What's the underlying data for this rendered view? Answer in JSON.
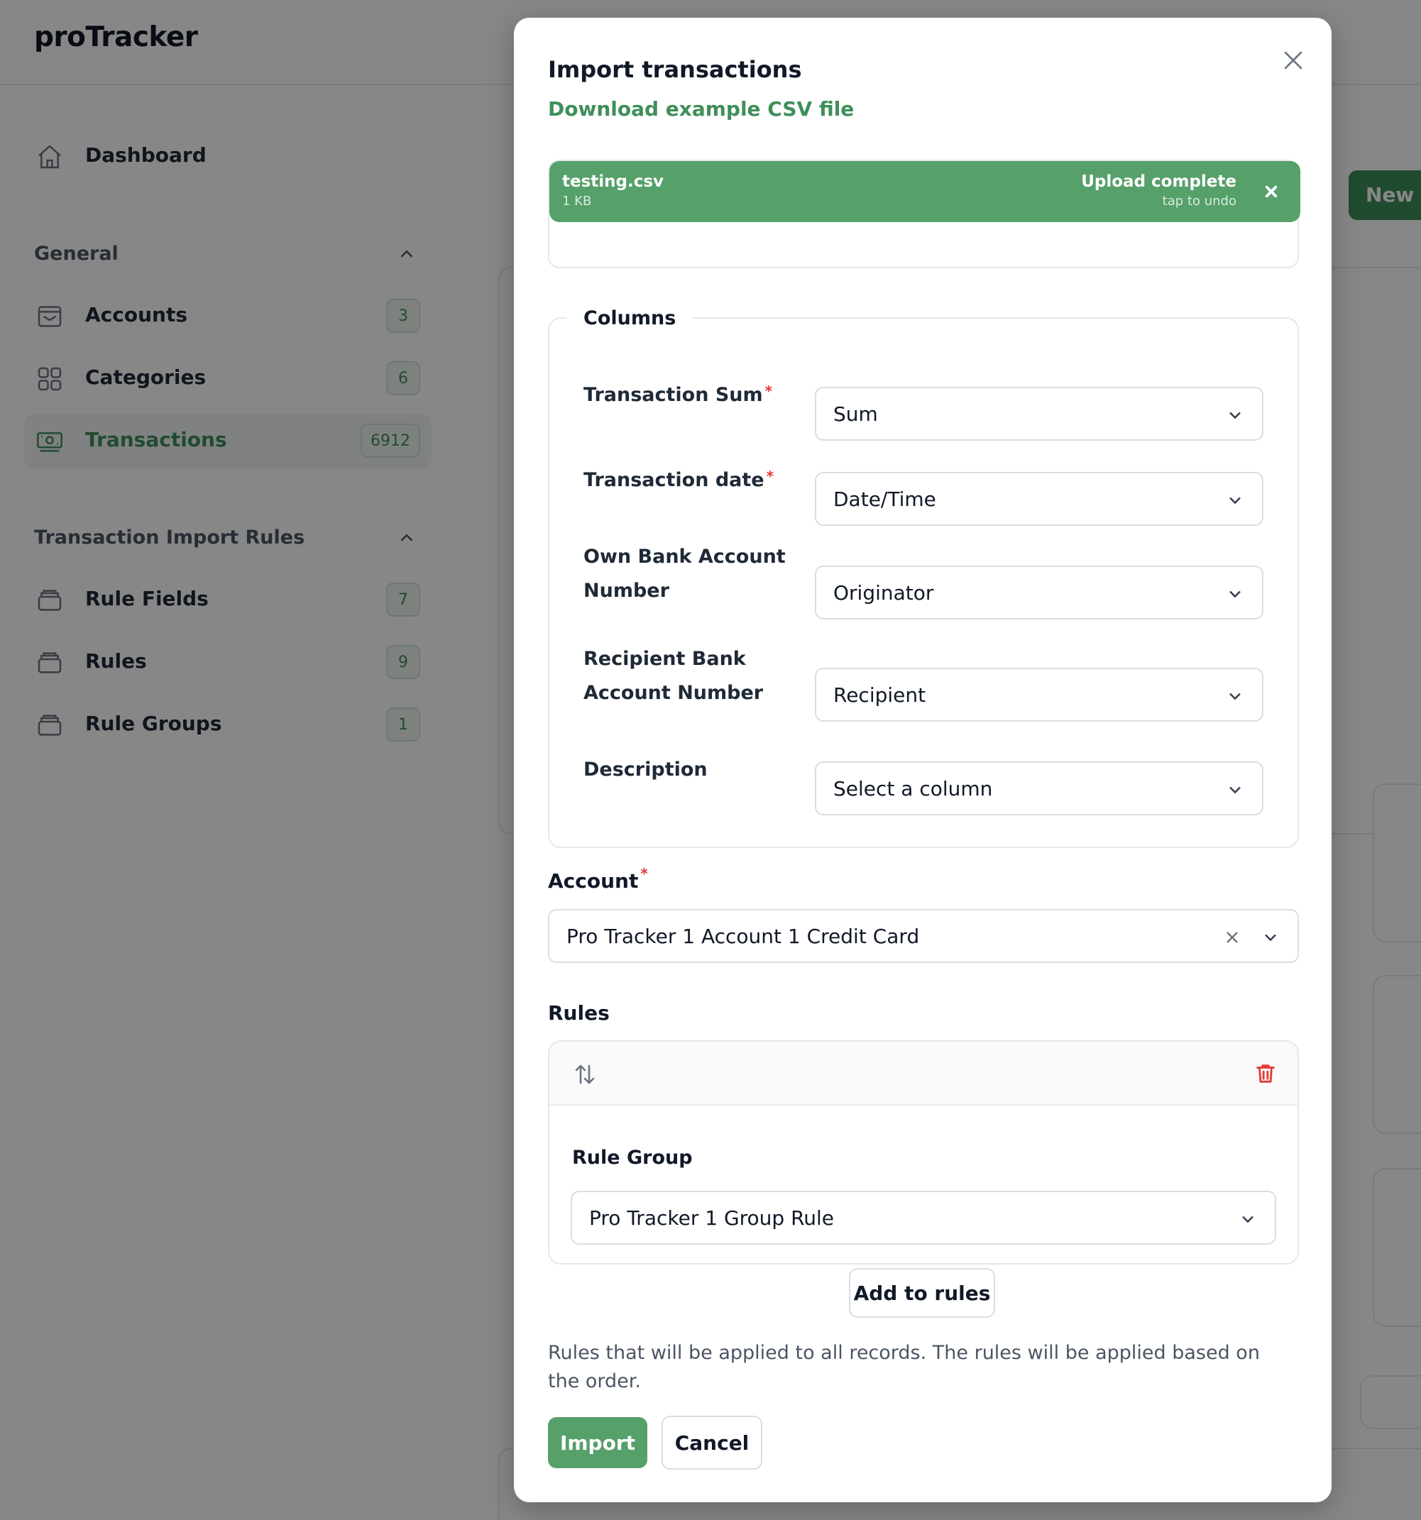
{
  "app": {
    "logo": "proTracker",
    "background_button": "New t"
  },
  "sidebar": {
    "dashboard": "Dashboard",
    "general_section": "General",
    "general_items": [
      {
        "label": "Accounts",
        "count": "3"
      },
      {
        "label": "Categories",
        "count": "6"
      },
      {
        "label": "Transactions",
        "count": "6912"
      }
    ],
    "rules_section": "Transaction Import Rules",
    "rules_items": [
      {
        "label": "Rule Fields",
        "count": "7"
      },
      {
        "label": "Rules",
        "count": "9"
      },
      {
        "label": "Rule Groups",
        "count": "1"
      }
    ]
  },
  "modal": {
    "title": "Import transactions",
    "download_link": "Download example CSV file",
    "upload": {
      "file_name": "testing.csv",
      "file_size": "1 KB",
      "status": "Upload complete",
      "undo_hint": "tap to undo"
    },
    "columns": {
      "legend": "Columns",
      "fields": [
        {
          "label": "Transaction Sum",
          "required": "*",
          "value": "Sum"
        },
        {
          "label": "Transaction date",
          "required": "*",
          "value": "Date/Time"
        },
        {
          "label_line1": "Own Bank Account",
          "label_line2": "Number",
          "value": "Originator"
        },
        {
          "label_line1": "Recipient Bank",
          "label_line2": "Account Number",
          "value": "Recipient"
        },
        {
          "label": "Description",
          "value": "Select a column"
        }
      ]
    },
    "account": {
      "label": "Account",
      "required": "*",
      "value": "Pro Tracker 1 Account 1 Credit Card"
    },
    "rules": {
      "label": "Rules",
      "rule_group_label": "Rule Group",
      "rule_group_value": "Pro Tracker 1 Group Rule",
      "add_button": "Add to rules",
      "help_text": "Rules that will be applied to all records. The rules will be applied based on the order."
    },
    "import_button": "Import",
    "cancel_button": "Cancel"
  },
  "colors": {
    "accent": "#56a06a",
    "accent_text": "#3f8f59",
    "danger": "#e53935"
  }
}
